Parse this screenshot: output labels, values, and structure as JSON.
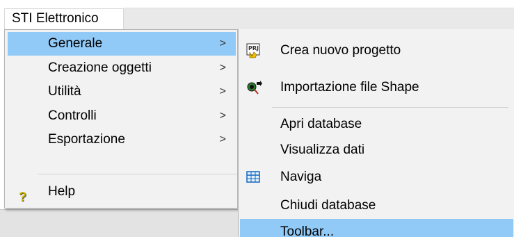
{
  "menubar": {
    "title": "STI Elettronico"
  },
  "main_menu": {
    "items": [
      {
        "label": "Generale",
        "arrow": ">"
      },
      {
        "label": "Creazione oggetti",
        "arrow": ">"
      },
      {
        "label": "Utilità",
        "arrow": ">"
      },
      {
        "label": "Controlli",
        "arrow": ">"
      },
      {
        "label": "Esportazione",
        "arrow": ">"
      }
    ],
    "help": {
      "label": "Help",
      "icon": "?"
    }
  },
  "submenu": {
    "items": [
      {
        "label": "Crea nuovo progetto",
        "icon": "PRJ"
      },
      {
        "label": "Importazione file Shape"
      },
      {
        "label": "Apri database"
      },
      {
        "label": "Visualizza dati"
      },
      {
        "label": "Naviga"
      },
      {
        "label": "Chiudi database"
      },
      {
        "label": "Toolbar..."
      }
    ]
  },
  "colors": {
    "highlight": "#91c9f7",
    "menu_bg": "#f2f2f2"
  }
}
